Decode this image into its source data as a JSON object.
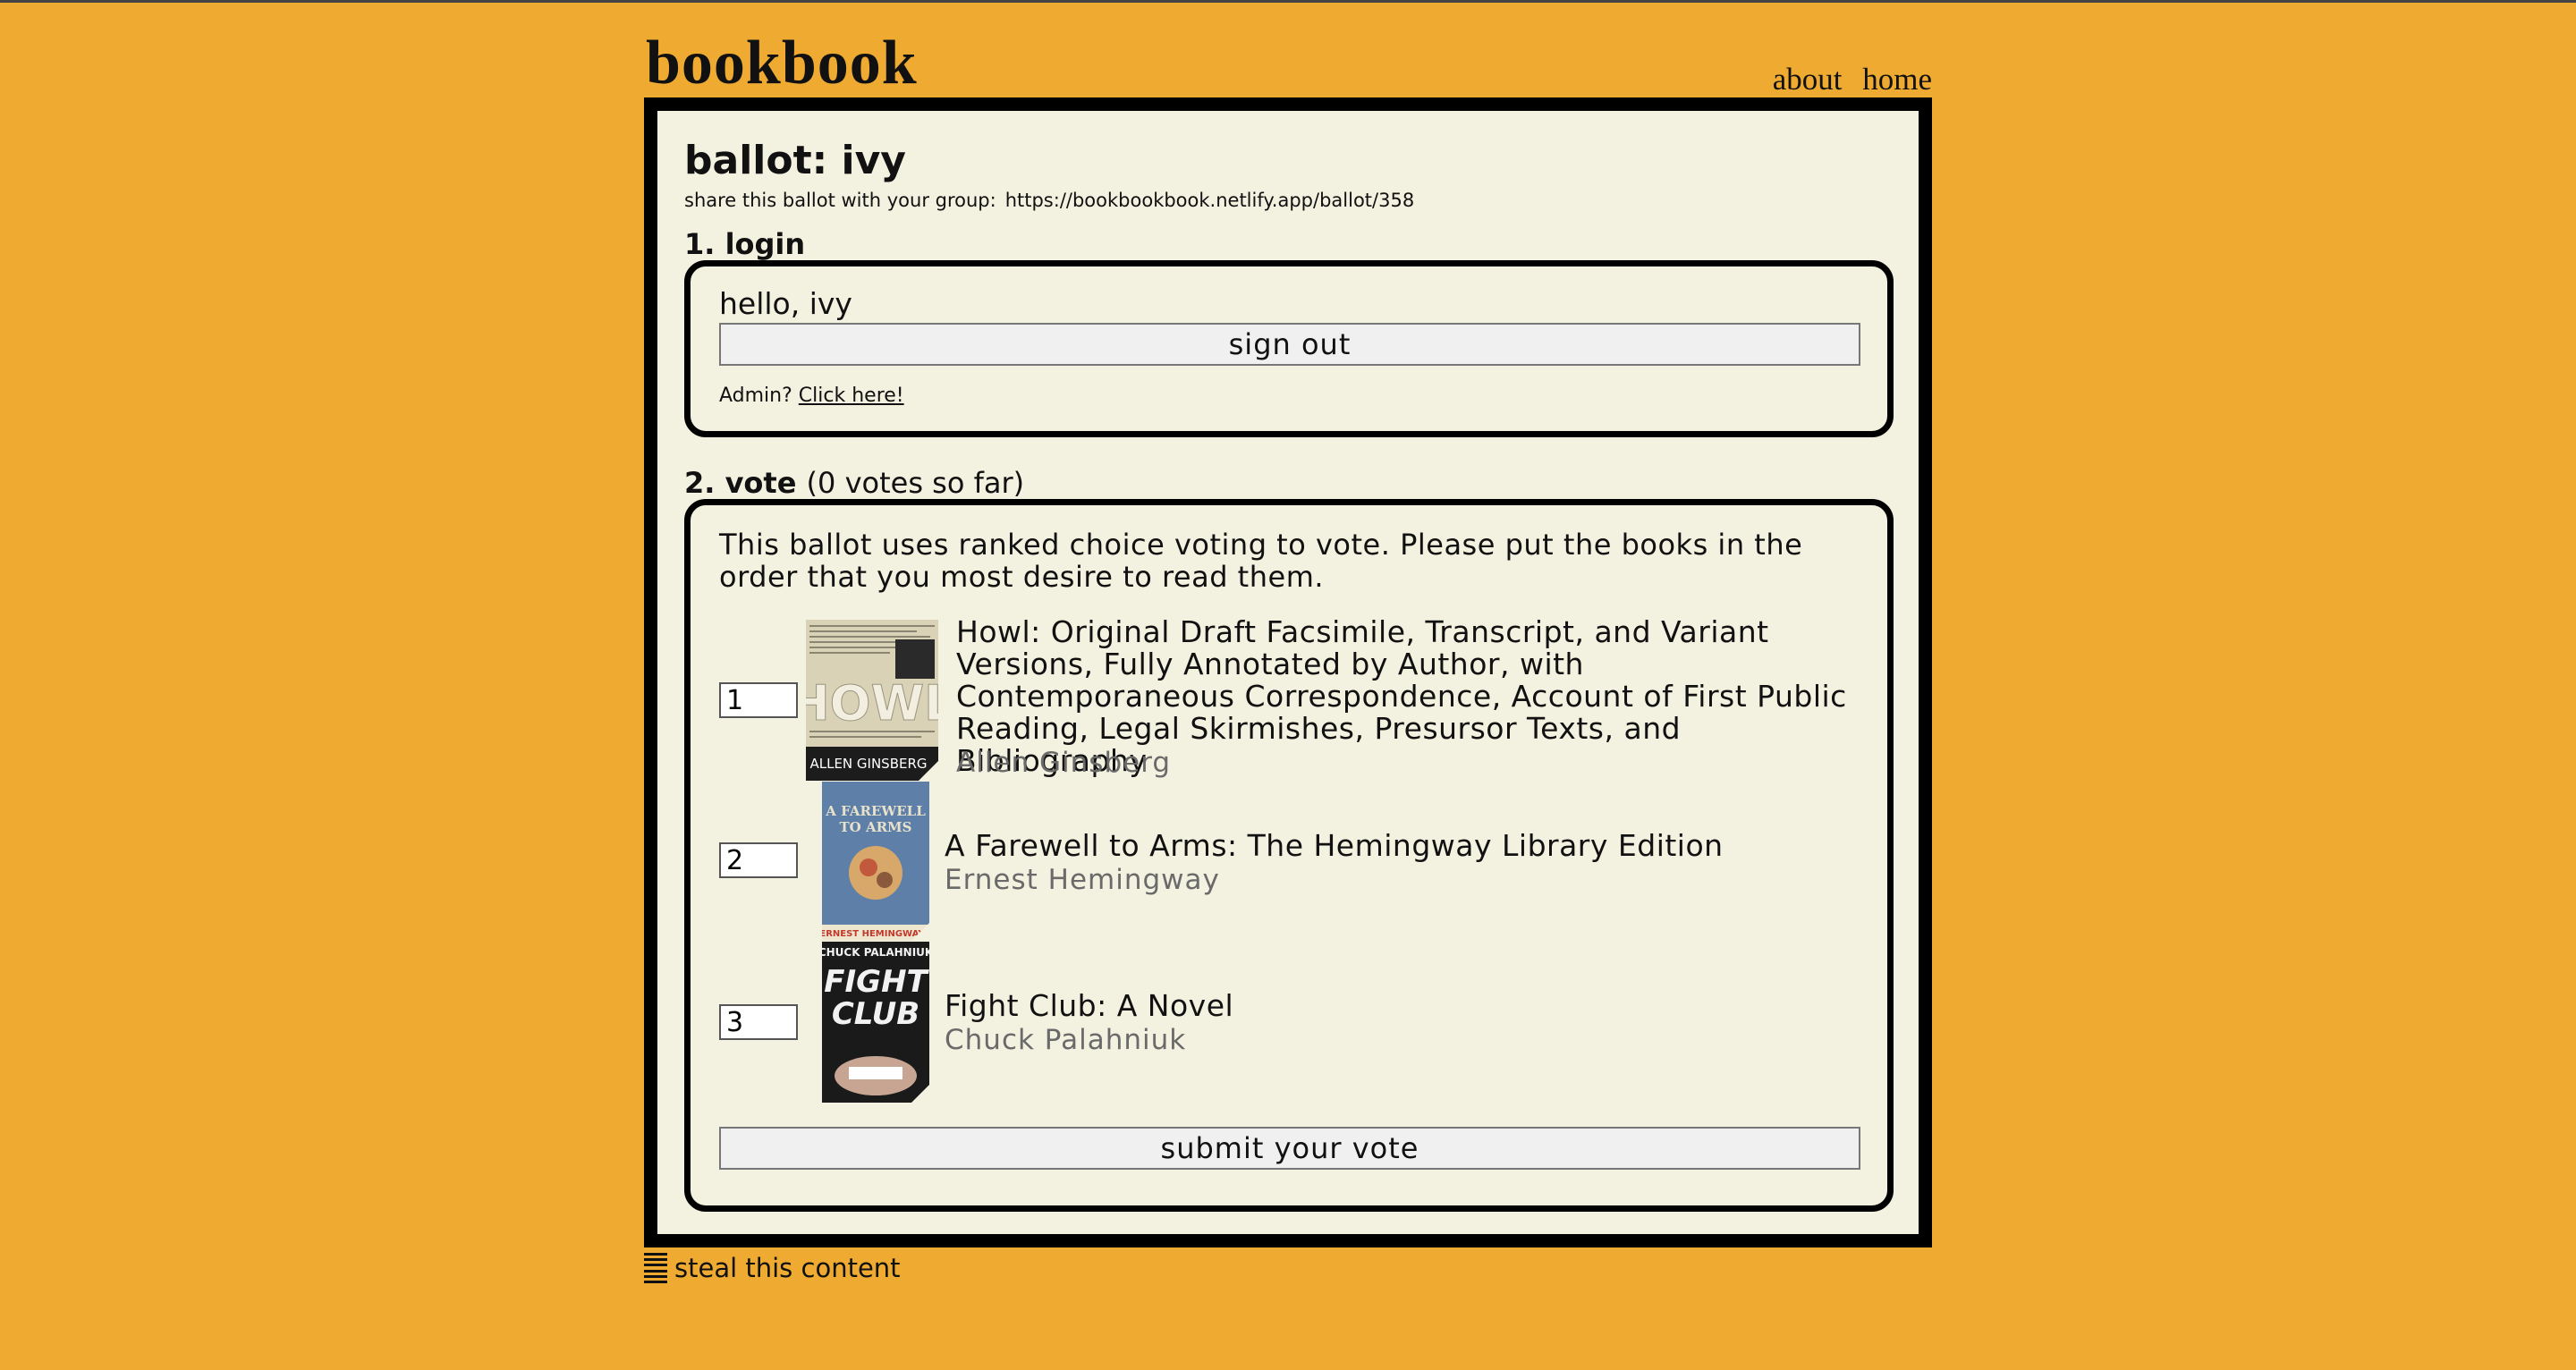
{
  "site": {
    "logo": "bookbook",
    "nav": [
      "about",
      "home"
    ]
  },
  "ballot": {
    "title": "ballot: ivy",
    "share_label": "share this ballot with your group:",
    "share_url": "https://bookbookbook.netlify.app/ballot/358"
  },
  "login": {
    "heading": "1. login",
    "greeting": "hello, ivy",
    "signout_label": "sign out",
    "admin_prompt": "Admin?",
    "admin_link": "Click here!"
  },
  "vote": {
    "heading": "2. vote",
    "votes_so_far": "(0 votes so far)",
    "instructions": "This ballot uses ranked choice voting to vote. Please put the books in the order that you most desire to read them.",
    "books": [
      {
        "rank": "1",
        "title": "Howl: Original Draft Facsimile, Transcript, and Variant Versions, Fully Annotated by Author, with Contemporaneous Correspondence, Account of First Public Reading, Legal Skirmishes, Presursor Texts, and Bibliography",
        "author": "Allen Ginsberg",
        "cover_text": "HOWL",
        "cover_author": "ALLEN GINSBERG"
      },
      {
        "rank": "2",
        "title": "A Farewell to Arms: The Hemingway Library Edition",
        "author": "Ernest Hemingway",
        "cover_text": "A FAREWELL TO ARMS",
        "cover_author": "ERNEST HEMINGWAY"
      },
      {
        "rank": "3",
        "title": "Fight Club: A Novel",
        "author": "Chuck Palahniuk",
        "cover_text": "FIGHT CLUB",
        "cover_author": "CHUCK PALAHNIUK"
      }
    ],
    "submit_label": "submit your vote"
  },
  "footer": {
    "text": "steal this content"
  },
  "colors": {
    "background": "#efaa32",
    "panel": "#f3f1df",
    "frame": "#000000"
  }
}
